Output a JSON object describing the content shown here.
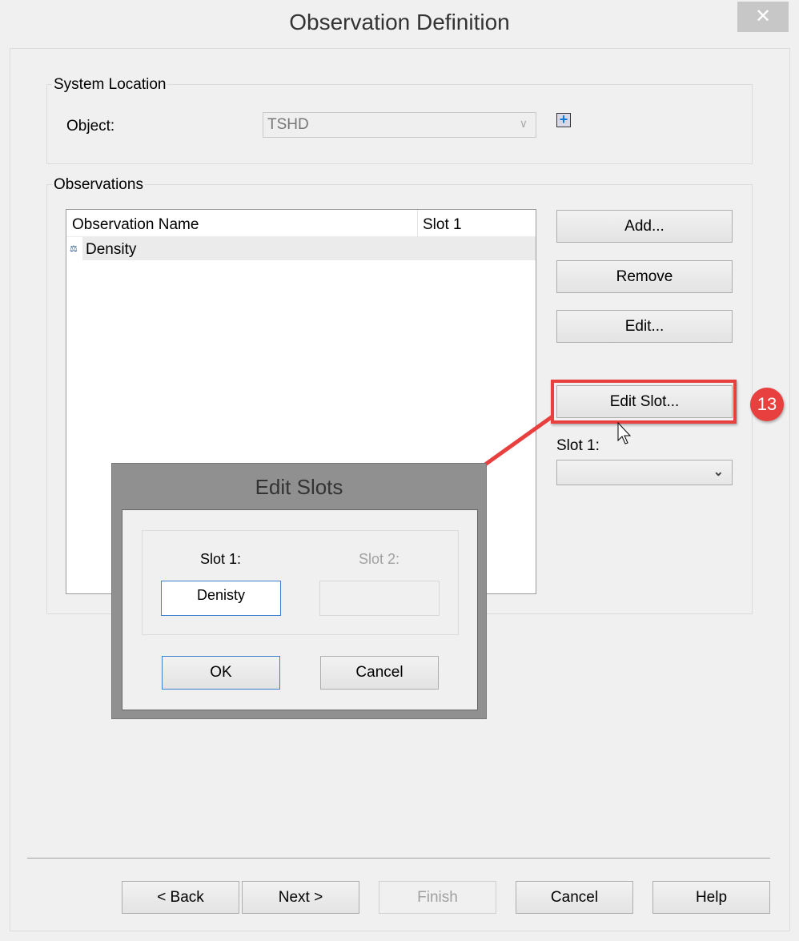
{
  "window": {
    "title": "Observation Definition",
    "close": "✕"
  },
  "system_location": {
    "label": "System Location",
    "object_label": "Object:",
    "object_value": "TSHD"
  },
  "observations": {
    "label": "Observations",
    "columns": [
      "Observation Name",
      "Slot 1"
    ],
    "rows": [
      {
        "name": "Density",
        "slot1": ""
      }
    ],
    "buttons": {
      "add": "Add...",
      "remove": "Remove",
      "edit": "Edit...",
      "edit_slot": "Edit Slot..."
    },
    "slot1_label": "Slot 1:",
    "slot1_value": ""
  },
  "annotation": {
    "step": "13",
    "color": "#e8403f"
  },
  "edit_slots": {
    "title": "Edit Slots",
    "slot1_label": "Slot 1:",
    "slot2_label": "Slot 2:",
    "slot1_value": "Denisty",
    "slot2_value": "",
    "ok": "OK",
    "cancel": "Cancel"
  },
  "footer": {
    "back": "< Back",
    "next": "Next >",
    "finish": "Finish",
    "cancel": "Cancel",
    "help": "Help"
  }
}
